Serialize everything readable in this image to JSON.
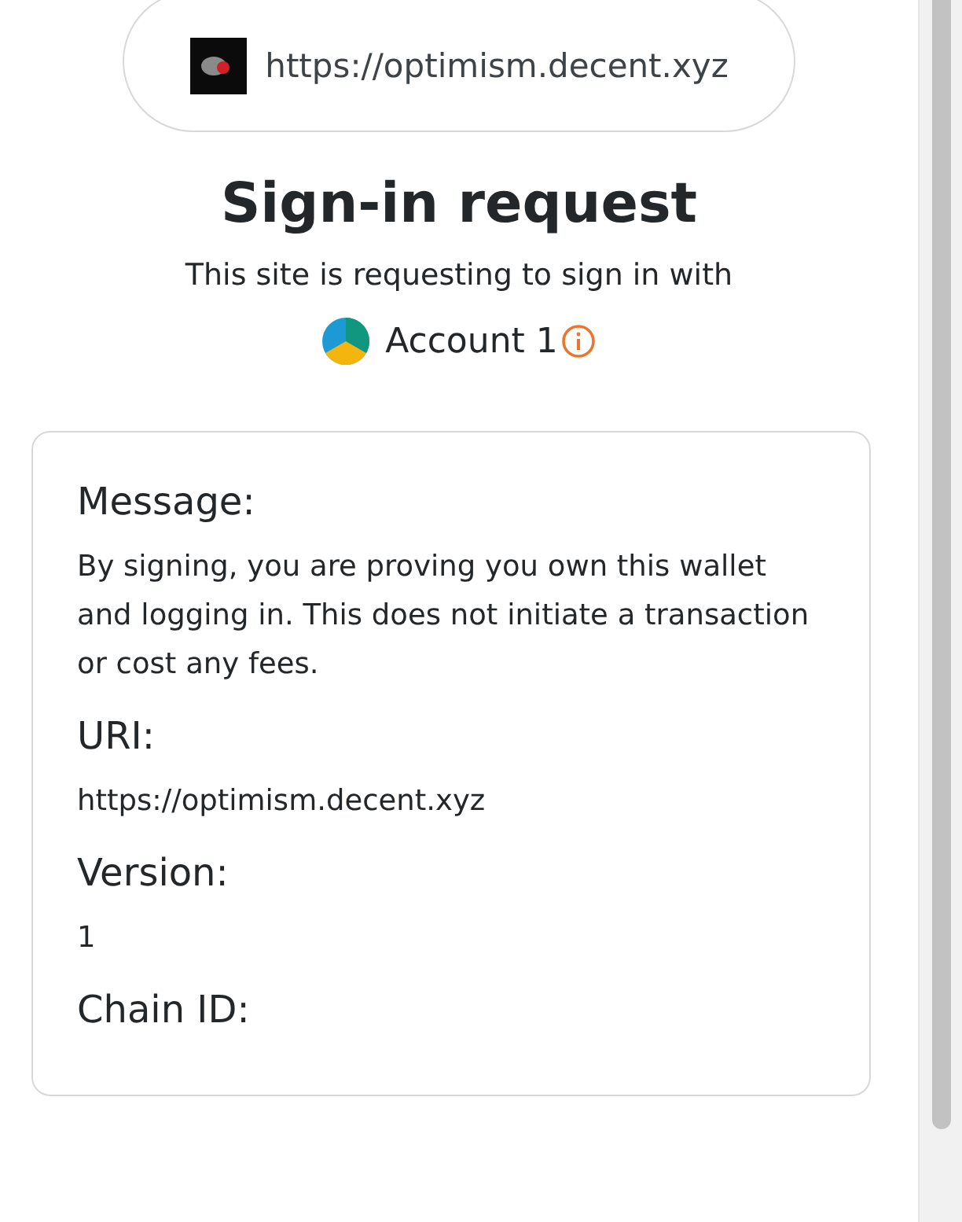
{
  "site": {
    "url": "https://optimism.decent.xyz"
  },
  "title": "Sign-in request",
  "subtitle": "This site is requesting to sign in with",
  "account": {
    "name": "Account 1"
  },
  "fields": [
    {
      "label": "Message:",
      "value": "By signing, you are proving you own this wallet and logging in. This does not initiate a transaction or cost any fees."
    },
    {
      "label": "URI:",
      "value": "https://optimism.decent.xyz"
    },
    {
      "label": "Version:",
      "value": "1"
    },
    {
      "label": "Chain ID:"
    }
  ]
}
